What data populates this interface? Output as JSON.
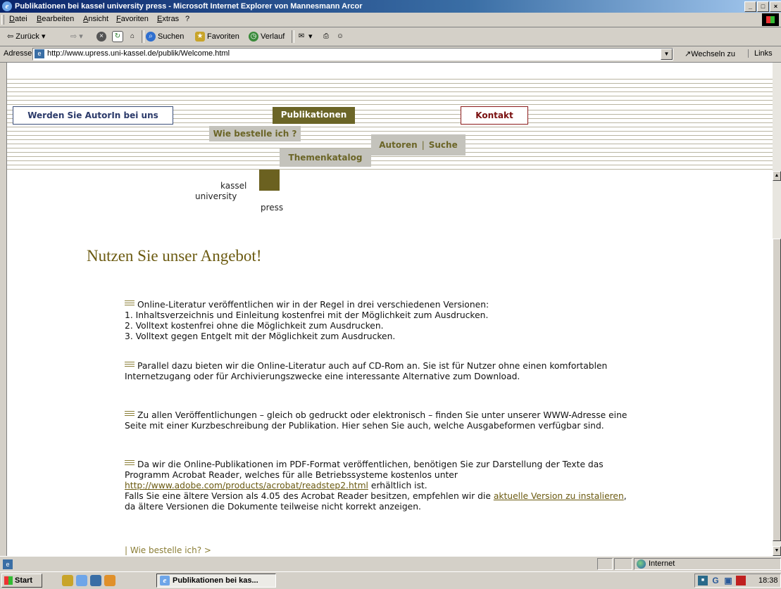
{
  "window": {
    "title": "Publikationen bei kassel university press - Microsoft Internet Explorer von Mannesmann Arcor",
    "controls": [
      "_",
      "□",
      "×"
    ]
  },
  "menu": [
    "Datei",
    "Bearbeiten",
    "Ansicht",
    "Favoriten",
    "Extras",
    "?"
  ],
  "toolbar": {
    "back": "Zurück",
    "search": "Suchen",
    "favorites": "Favoriten",
    "history": "Verlauf"
  },
  "address": {
    "label": "Adresse",
    "url": "http://www.upress.uni-kassel.de/publik/Welcome.html",
    "go": "Wechseln zu",
    "links": "Links"
  },
  "nav": {
    "author": "Werden Sie AutorIn bei uns",
    "publications": "Publikationen",
    "contact": "Kontakt",
    "order": "Wie bestelle ich ?",
    "catalog": "Themenkatalog",
    "authors": "Autoren",
    "separator": "|",
    "search": "Suche"
  },
  "logo": {
    "line1": "kassel",
    "line2": "university",
    "line3": "press",
    "color": "#6b6120"
  },
  "content": {
    "heading": "Nutzen Sie unser Angebot!",
    "p1": {
      "intro": "Online-Literatur veröffentlichen wir in der Regel in drei verschiedenen Versionen:",
      "items": [
        "1. Inhaltsverzeichnis und Einleitung kostenfrei mit der Möglichkeit zum Ausdrucken.",
        "2. Volltext kostenfrei ohne die Möglichkeit zum Ausdrucken.",
        "3. Volltext gegen Entgelt mit der Möglichkeit zum Ausdrucken."
      ]
    },
    "p2": "Parallel dazu bieten wir die Online-Literatur auch auf CD-Rom an. Sie ist für Nutzer ohne einen komfortablen Internetzugang oder für Archivierungszwecke eine interessante Alternative zum Download.",
    "p3": "Zu allen Veröffentlichungen – gleich ob gedruckt oder elektronisch – finden Sie unter unserer WWW-Adresse eine Seite mit einer Kurzbeschreibung der Publikation. Hier sehen Sie auch, welche Ausgabeformen verfügbar sind.",
    "p4": {
      "text1": "Da wir die Online-Publikationen im PDF-Format veröffentlichen, benötigen Sie zur Darstellung der Texte das Programm Acrobat Reader, welches für alle Betriebssysteme kostenlos unter",
      "link1": "http://www.adobe.com/products/acrobat/readstep2.html",
      "text2": "erhältlich ist.",
      "text3": "Falls Sie eine ältere Version als 4.05 des Acrobat Reader besitzen, empfehlen wir die",
      "link2": "aktuelle Version zu instalieren",
      "text4": ", da ältere Versionen die Dokumente teilweise nicht korrekt anzeigen."
    },
    "bottom_link": "| Wie bestelle ich? >"
  },
  "status": {
    "zone": "Internet"
  },
  "taskbar": {
    "start": "Start",
    "task": "Publikationen bei kas...",
    "clock": "18:38"
  }
}
